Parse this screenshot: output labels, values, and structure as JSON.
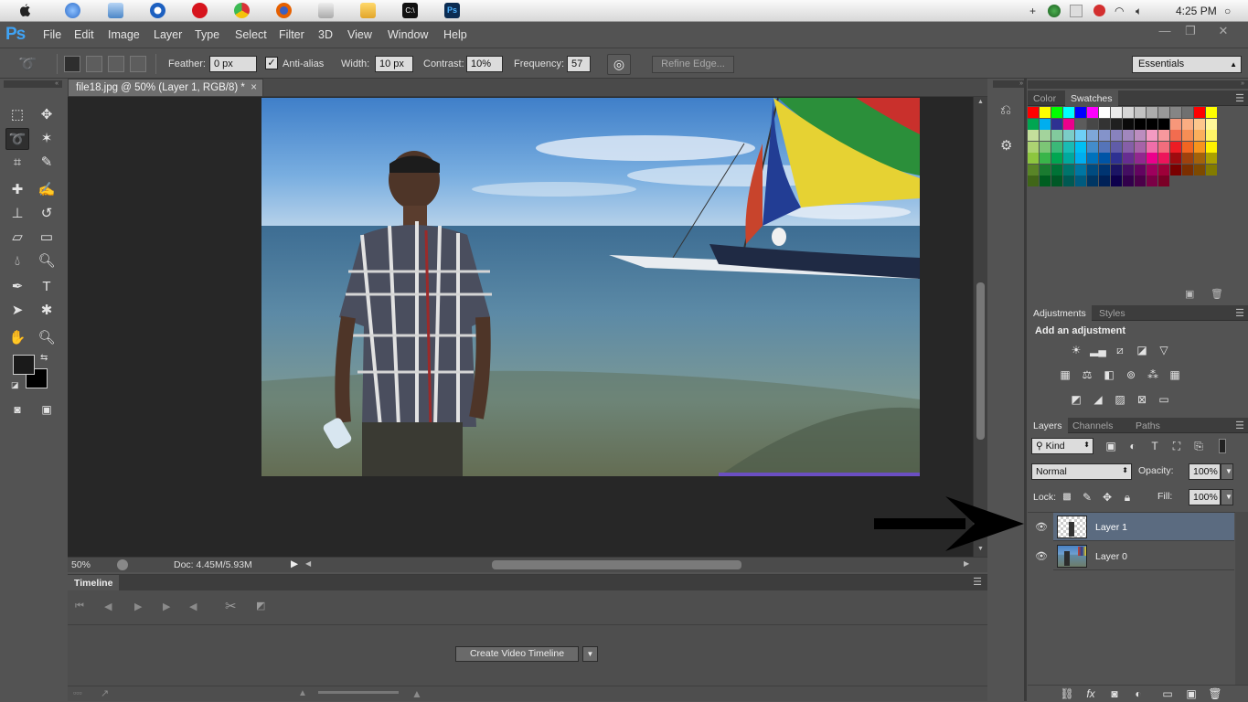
{
  "taskbar": {
    "apps": [
      "quicktime-icon",
      "finder-icon",
      "quicktime-search-icon",
      "opera-icon",
      "chrome-icon",
      "firefox-icon",
      "mail-icon",
      "folder-icon",
      "terminal-icon",
      "photoshop-icon"
    ],
    "terminal_label": "C:\\",
    "ps_label": "Ps",
    "clock": "4:25 PM"
  },
  "menubar": {
    "logo": "Ps",
    "items": [
      "File",
      "Edit",
      "Image",
      "Layer",
      "Type",
      "Select",
      "Filter",
      "3D",
      "View",
      "Window",
      "Help"
    ]
  },
  "options": {
    "feather_label": "Feather:",
    "feather_value": "0 px",
    "antialias_label": "Anti-alias",
    "antialias_checked": true,
    "width_label": "Width:",
    "width_value": "10 px",
    "contrast_label": "Contrast:",
    "contrast_value": "10%",
    "frequency_label": "Frequency:",
    "frequency_value": "57",
    "refine_edge": "Refine Edge...",
    "workspace": "Essentials"
  },
  "document": {
    "tab_title": "file18.jpg @ 50% (Layer 1, RGB/8) *",
    "zoom": "50%",
    "doc_size": "Doc: 4.45M/5.93M"
  },
  "timeline": {
    "title": "Timeline",
    "create_button": "Create Video Timeline"
  },
  "color_panel": {
    "tabs": [
      "Color",
      "Swatches"
    ],
    "active_tab": "Swatches"
  },
  "adjustments": {
    "tabs": [
      "Adjustments",
      "Styles"
    ],
    "heading": "Add an adjustment"
  },
  "layers_panel": {
    "tabs": [
      "Layers",
      "Channels",
      "Paths"
    ],
    "filter_kind": "Kind",
    "blend_mode": "Normal",
    "opacity_label": "Opacity:",
    "opacity_value": "100%",
    "lock_label": "Lock:",
    "fill_label": "Fill:",
    "fill_value": "100%",
    "layers": [
      {
        "name": "Layer 1",
        "selected": true
      },
      {
        "name": "Layer 0",
        "selected": false
      }
    ]
  },
  "colors": {
    "accent": "#3fa3f5",
    "selected_layer": "#5b6b80"
  }
}
